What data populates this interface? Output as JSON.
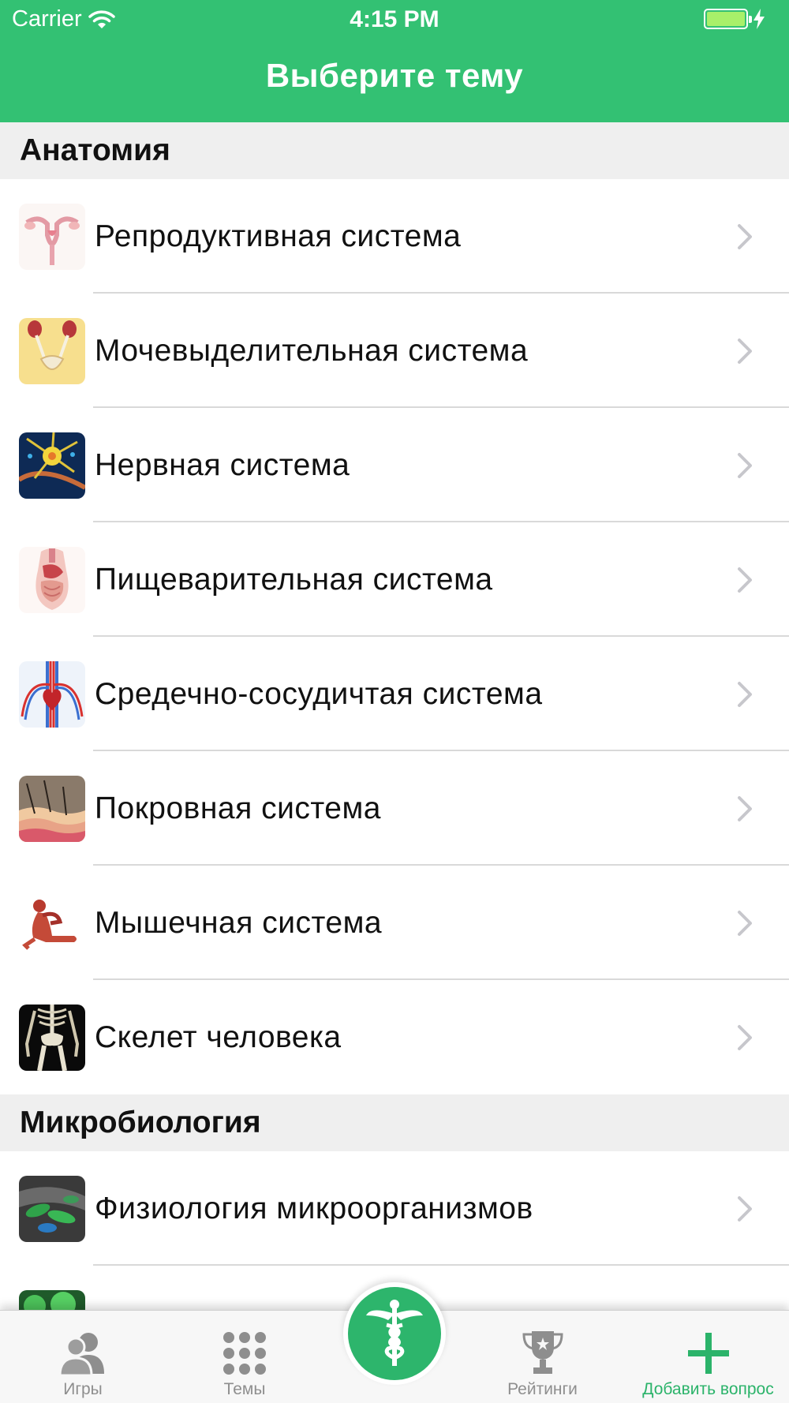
{
  "status_bar": {
    "carrier": "Carrier",
    "time": "4:15 PM"
  },
  "nav": {
    "title": "Выберите тему"
  },
  "colors": {
    "accent": "#33c173",
    "section_bg": "#efefef"
  },
  "sections": [
    {
      "title": "Анатомия",
      "items": [
        {
          "label": "Репродуктивная система",
          "icon": "reproductive-system-image"
        },
        {
          "label": "Мочевыделительная система",
          "icon": "urinary-system-image"
        },
        {
          "label": "Нервная система",
          "icon": "nervous-system-image"
        },
        {
          "label": "Пищеварительная система",
          "icon": "digestive-system-image"
        },
        {
          "label": "Средечно-сосудичтая система",
          "icon": "cardiovascular-system-image"
        },
        {
          "label": "Покровная система",
          "icon": "integumentary-system-image"
        },
        {
          "label": "Мышечная система",
          "icon": "muscular-system-image"
        },
        {
          "label": "Скелет человека",
          "icon": "skeleton-image"
        }
      ]
    },
    {
      "title": "Микробиология",
      "items": [
        {
          "label": "Физиология микроорганизмов",
          "icon": "microorganisms-image"
        },
        {
          "label": "",
          "icon": "bacteria-image"
        }
      ]
    }
  ],
  "tabbar": {
    "tabs": [
      {
        "label": "Игры",
        "icon": "users-icon"
      },
      {
        "label": "Темы",
        "icon": "grid-icon"
      },
      {
        "label": "",
        "icon": "caduceus-icon"
      },
      {
        "label": "Рейтинги",
        "icon": "trophy-icon"
      },
      {
        "label": "Добавить вопрос",
        "icon": "plus-icon"
      }
    ]
  }
}
